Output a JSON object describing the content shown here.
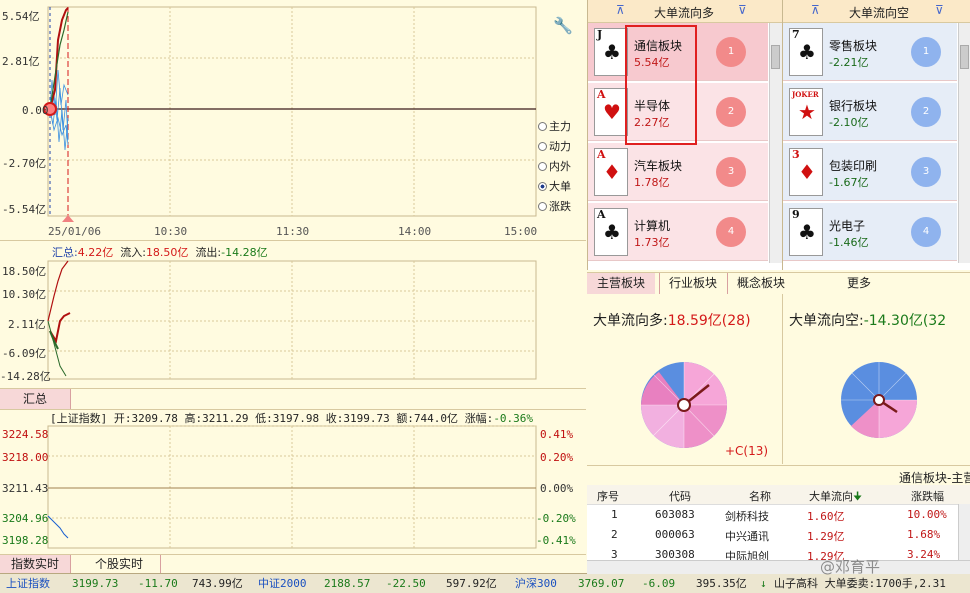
{
  "chart1": {
    "y_labels": [
      "5.54亿",
      "2.81亿",
      "0.00",
      "-2.70亿",
      "-5.54亿"
    ],
    "x_labels": [
      "25/01/06",
      "10:30",
      "11:30",
      "14:00",
      "15:00"
    ],
    "options": [
      "主力",
      "动力",
      "内外",
      "大单",
      "涨跌"
    ],
    "selected_option": "大单"
  },
  "chart2": {
    "summary_label": "汇总:",
    "summary_value": "4.22亿",
    "inflow_label": "流入:",
    "inflow_value": "18.50亿",
    "outflow_label": "流出:",
    "outflow_value": "-14.28亿",
    "y_labels": [
      "18.50亿",
      "10.30亿",
      "2.11亿",
      "-6.09亿",
      "-14.28亿"
    ]
  },
  "mid_tab": "汇总",
  "index_header": {
    "name": "[上证指数]",
    "open_label": "开:",
    "open": "3209.78",
    "high_label": "高:",
    "high": "3211.29",
    "low_label": "低:",
    "low": "3197.98",
    "close_label": "收:",
    "close": "3199.73",
    "amount_label": "额:",
    "amount": "744.0亿",
    "change_label": "涨幅:",
    "change": "-0.36%"
  },
  "chart3": {
    "y_left": [
      "3224.58",
      "3218.00",
      "3211.43",
      "3204.96",
      "3198.28"
    ],
    "y_right": [
      "0.41%",
      "0.20%",
      "0.00%",
      "-0.20%",
      "-0.41%"
    ]
  },
  "bottom_tabs": [
    "指数实时",
    "个股实时"
  ],
  "status_bar": [
    {
      "name": "上证指数",
      "price": "3199.73",
      "chg": "-11.70",
      "amt": "743.99亿"
    },
    {
      "name": "中证2000",
      "price": "2188.57",
      "chg": "-22.50",
      "amt": "597.92亿"
    },
    {
      "name": "沪深300",
      "price": "3769.07",
      "chg": "-6.09",
      "amt": "395.35亿"
    }
  ],
  "status_extra": "山子高科  大单委卖:1700手,2.31",
  "watermark": "@邓育平",
  "inflow_panel": {
    "title": "大单流向多",
    "items": [
      {
        "rank": "1",
        "name": "通信板块",
        "value": "5.54亿",
        "card_rank": "J",
        "card_suit": "♣",
        "card_color": "#111"
      },
      {
        "rank": "2",
        "name": "半导体",
        "value": "2.27亿",
        "card_rank": "A",
        "card_suit": "♥",
        "card_color": "#d01010"
      },
      {
        "rank": "3",
        "name": "汽车板块",
        "value": "1.78亿",
        "card_rank": "A",
        "card_suit": "♦",
        "card_color": "#d01010"
      },
      {
        "rank": "4",
        "name": "计算机",
        "value": "1.73亿",
        "card_rank": "A",
        "card_suit": "♣",
        "card_color": "#111"
      }
    ]
  },
  "outflow_panel": {
    "title": "大单流向空",
    "items": [
      {
        "rank": "1",
        "name": "零售板块",
        "value": "-2.21亿",
        "card_rank": "7",
        "card_suit": "♣",
        "card_color": "#111"
      },
      {
        "rank": "2",
        "name": "银行板块",
        "value": "-2.10亿",
        "card_rank": "JOKER",
        "card_suit": "★",
        "card_color": "#d01010"
      },
      {
        "rank": "3",
        "name": "包装印刷",
        "value": "-1.67亿",
        "card_rank": "3",
        "card_suit": "♦",
        "card_color": "#d01010"
      },
      {
        "rank": "4",
        "name": "光电子",
        "value": "-1.46亿",
        "card_rank": "9",
        "card_suit": "♣",
        "card_color": "#111"
      }
    ]
  },
  "sector_tabs": [
    "主营板块",
    "行业板块",
    "概念板块",
    "更多"
  ],
  "long_summary": {
    "label": "大单流向多:",
    "value": "18.59亿(28)",
    "extra": "+C(13)"
  },
  "short_summary": {
    "label": "大单流向空:",
    "value": "-14.30亿(32"
  },
  "table": {
    "caption": "通信板块-主营",
    "headers": [
      "序号",
      "代码",
      "名称",
      "大单流向",
      "涨跌幅"
    ],
    "rows": [
      {
        "no": "1",
        "code": "603083",
        "name": "剑桥科技",
        "flow": "1.60亿",
        "pct": "10.00%"
      },
      {
        "no": "2",
        "code": "000063",
        "name": "中兴通讯",
        "flow": "1.29亿",
        "pct": "1.68%"
      },
      {
        "no": "3",
        "code": "300308",
        "name": "中际旭创",
        "flow": "1.29亿",
        "pct": "3.24%"
      }
    ]
  },
  "colors": {
    "accent_red": "#d41a1a",
    "accent_green": "#1a7a1a",
    "panel_bg": "#fffbe0",
    "highlight": "#f9d8dc",
    "outflow_bg": "#dce6f5",
    "inflow_circle": "#f28a8a",
    "outflow_circle": "#8fb3ee"
  }
}
